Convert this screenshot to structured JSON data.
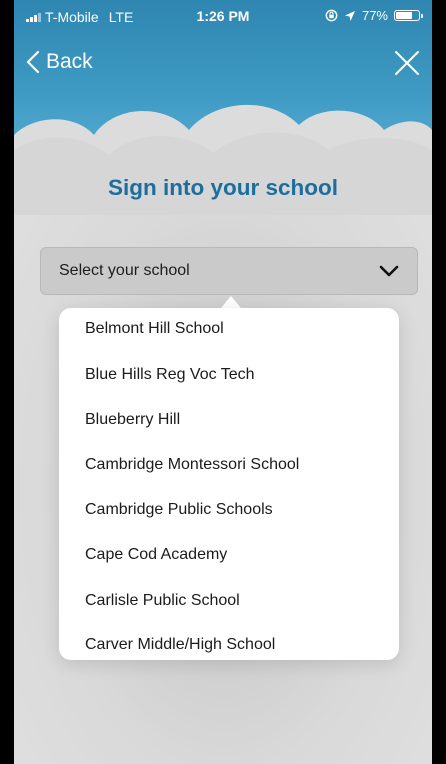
{
  "status": {
    "carrier": "T-Mobile",
    "network": "LTE",
    "time": "1:26 PM",
    "battery": "77%",
    "battery_level": 0.77
  },
  "nav": {
    "back_label": "Back"
  },
  "title": "Sign into your school",
  "select": {
    "placeholder": "Select your school"
  },
  "schools": [
    "Belmont Hill School",
    "Blue Hills Reg Voc Tech",
    "Blueberry Hill",
    "Cambridge Montessori School",
    "Cambridge Public Schools",
    "Cape Cod Academy",
    "Carlisle Public School",
    "Carver Middle/High School"
  ],
  "colors": {
    "sky": "#2e86b1",
    "title": "#1c6e9e",
    "background": "#d8d8d8"
  }
}
